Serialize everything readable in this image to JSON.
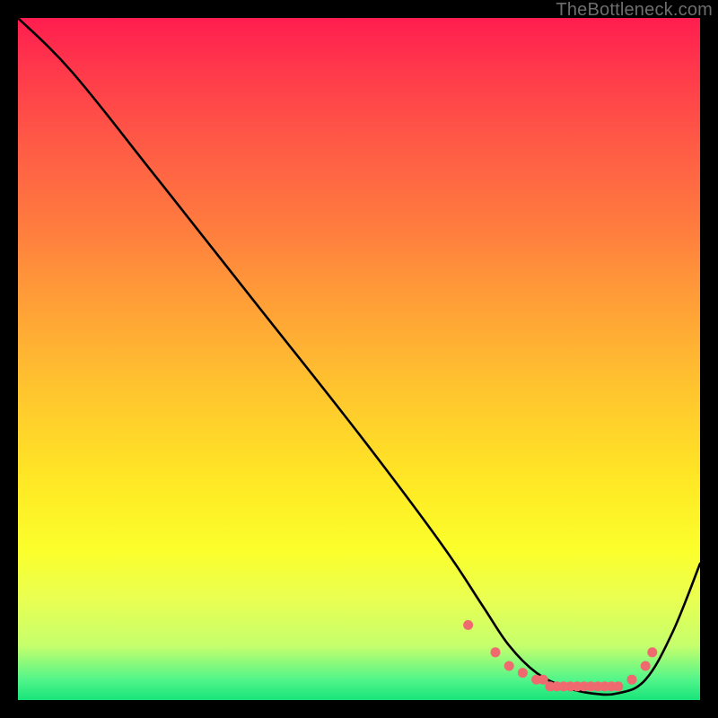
{
  "watermark": "TheBottleneck.com",
  "chart_data": {
    "type": "line",
    "title": "",
    "xlabel": "",
    "ylabel": "",
    "xlim": [
      0,
      100
    ],
    "ylim": [
      0,
      100
    ],
    "series": [
      {
        "name": "curve",
        "x": [
          0,
          8,
          20,
          35,
          50,
          62,
          68,
          72,
          76,
          80,
          84,
          88,
          92,
          96,
          100
        ],
        "values": [
          100,
          92,
          77,
          58,
          39,
          23,
          14,
          8,
          4,
          2,
          1,
          1,
          3,
          10,
          20
        ]
      }
    ],
    "markers": {
      "name": "dots",
      "x": [
        66,
        70,
        72,
        74,
        76,
        77,
        78,
        79,
        80,
        81,
        82,
        83,
        84,
        85,
        86,
        87,
        88,
        90,
        92,
        93
      ],
      "values": [
        11,
        7,
        5,
        4,
        3,
        3,
        2,
        2,
        2,
        2,
        2,
        2,
        2,
        2,
        2,
        2,
        2,
        3,
        5,
        7
      ]
    }
  }
}
